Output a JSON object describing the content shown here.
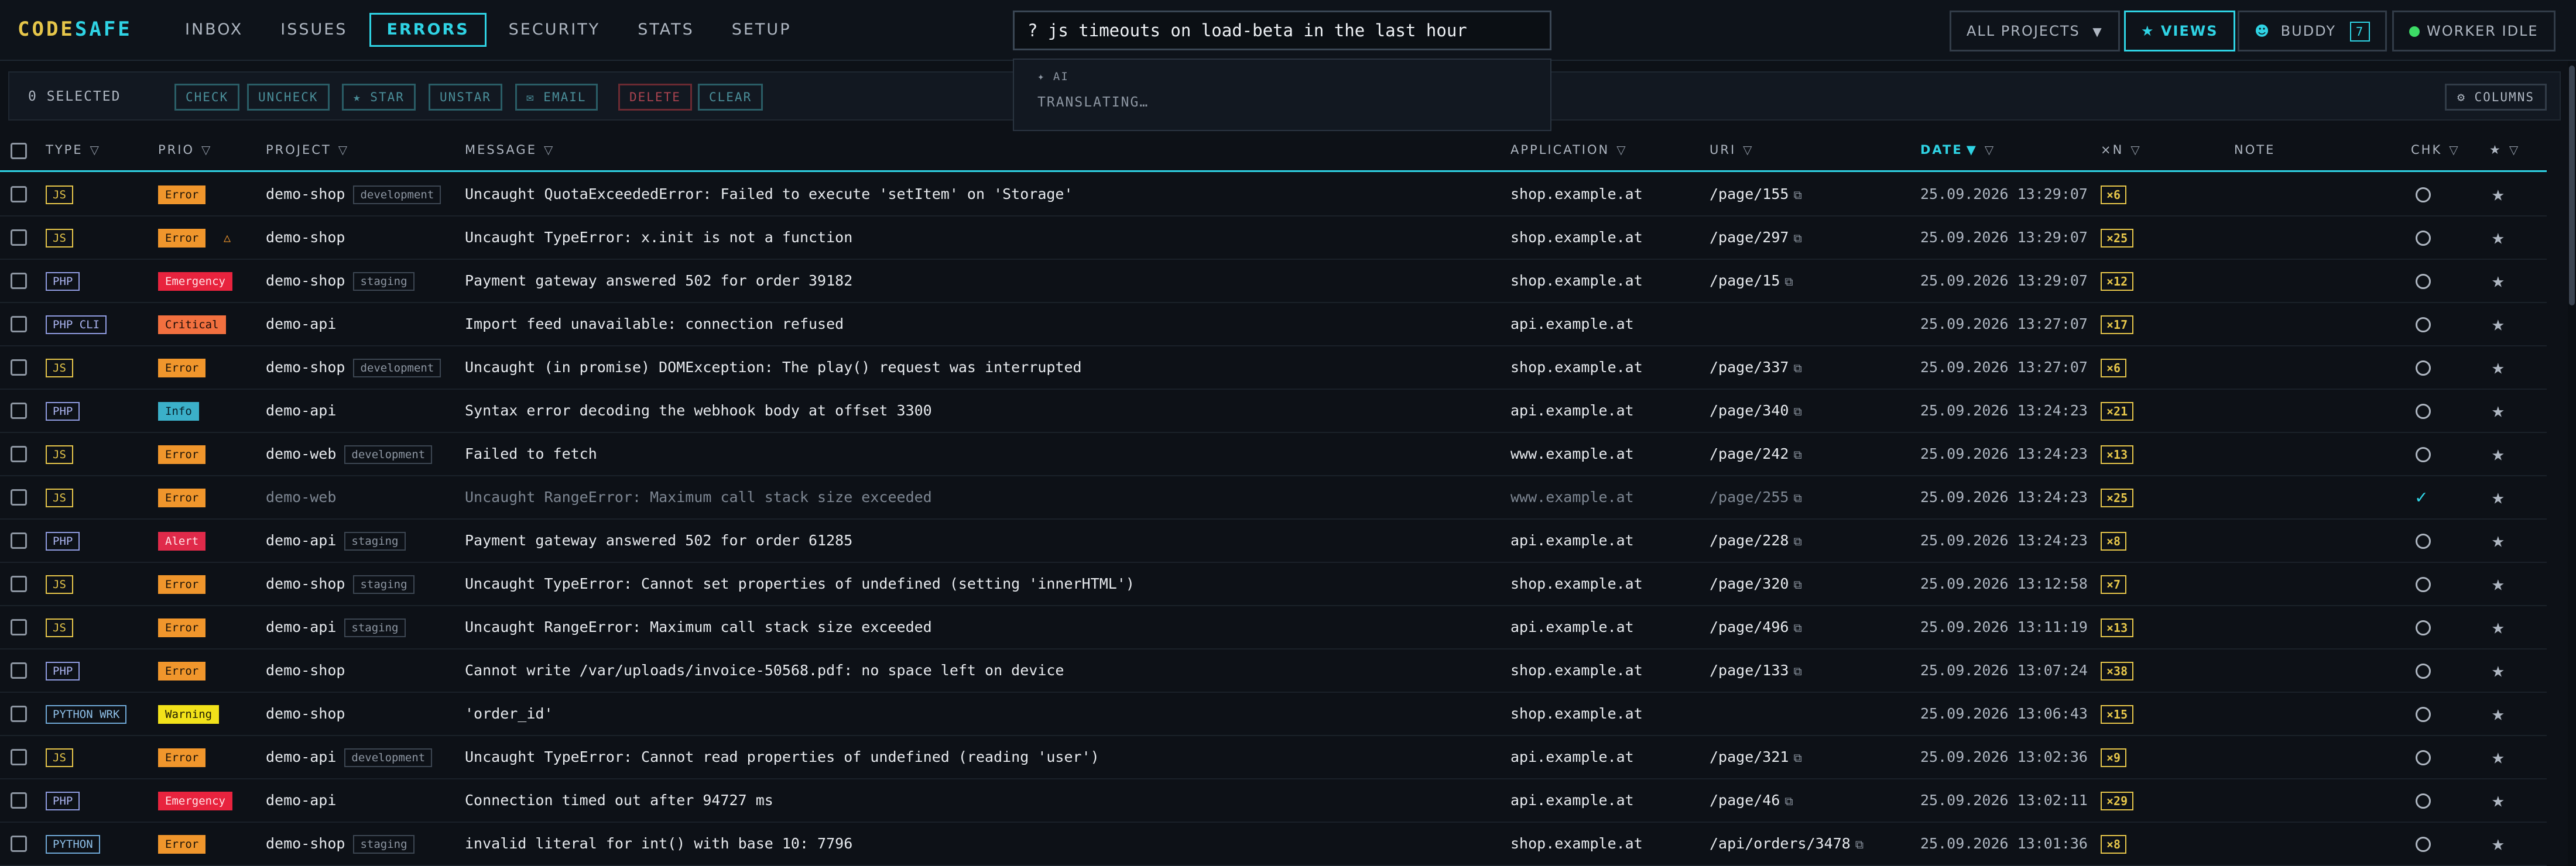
{
  "brand": {
    "part1": "CODE",
    "part2": "SAFE"
  },
  "nav": [
    {
      "label": "INBOX"
    },
    {
      "label": "ISSUES"
    },
    {
      "label": "ERRORS"
    },
    {
      "label": "SECURITY"
    },
    {
      "label": "STATS"
    },
    {
      "label": "SETUP"
    }
  ],
  "search": {
    "value": "? js timeouts on load-beta in the last hour"
  },
  "ai_dropdown": {
    "tag": "✦ AI",
    "status": "TRANSLATING…"
  },
  "toolbar": {
    "projects_label": "ALL PROJECTS",
    "views_label": "VIEWS",
    "buddy_label": "BUDDY",
    "buddy_count": "7",
    "worker_label": "WORKER IDLE"
  },
  "selection": {
    "count_label": "0 SELECTED",
    "check": "CHECK",
    "uncheck": "UNCHECK",
    "star": "STAR",
    "unstar": "UNSTAR",
    "email": "EMAIL",
    "delete": "DELETE",
    "clear": "CLEAR",
    "columns": "COLUMNS"
  },
  "columns": {
    "type": "TYPE",
    "prio": "PRIO",
    "project": "PROJECT",
    "message": "MESSAGE",
    "application": "APPLICATION",
    "uri": "URI",
    "date": "DATE",
    "count": "×N",
    "note": "NOTE",
    "chk": "CHK",
    "star": "★"
  },
  "colors": {
    "accent": "#2fd3e4",
    "brand_yellow": "#e6c64a"
  },
  "rows": [
    {
      "type": "JS",
      "prio": "Error",
      "project": "demo-shop",
      "env": "development",
      "message": "Uncaught QuotaExceededError: Failed to execute 'setItem' on 'Storage'",
      "app": "shop.example.at",
      "uri": "/page/155",
      "date": "25.09.2026 13:29:07",
      "count": "×6",
      "checked": false,
      "dim": false,
      "warn": false
    },
    {
      "type": "JS",
      "prio": "Error",
      "project": "demo-shop",
      "env": "",
      "message": "Uncaught TypeError: x.init is not a function",
      "app": "shop.example.at",
      "uri": "/page/297",
      "date": "25.09.2026 13:29:07",
      "count": "×25",
      "checked": false,
      "dim": false,
      "warn": true
    },
    {
      "type": "PHP",
      "prio": "Emergency",
      "project": "demo-shop",
      "env": "staging",
      "message": "Payment gateway answered 502 for order 39182",
      "app": "shop.example.at",
      "uri": "/page/15",
      "date": "25.09.2026 13:29:07",
      "count": "×12",
      "checked": false,
      "dim": false,
      "warn": false
    },
    {
      "type": "PHP CLI",
      "prio": "Critical",
      "project": "demo-api",
      "env": "",
      "message": "Import feed unavailable: connection refused",
      "app": "api.example.at",
      "uri": "",
      "date": "25.09.2026 13:27:07",
      "count": "×17",
      "checked": false,
      "dim": false,
      "warn": false
    },
    {
      "type": "JS",
      "prio": "Error",
      "project": "demo-shop",
      "env": "development",
      "message": "Uncaught (in promise) DOMException: The play() request was interrupted",
      "app": "shop.example.at",
      "uri": "/page/337",
      "date": "25.09.2026 13:27:07",
      "count": "×6",
      "checked": false,
      "dim": false,
      "warn": false
    },
    {
      "type": "PHP",
      "prio": "Info",
      "project": "demo-api",
      "env": "",
      "message": "Syntax error decoding the webhook body at offset 3300",
      "app": "api.example.at",
      "uri": "/page/340",
      "date": "25.09.2026 13:24:23",
      "count": "×21",
      "checked": false,
      "dim": false,
      "warn": false
    },
    {
      "type": "JS",
      "prio": "Error",
      "project": "demo-web",
      "env": "development",
      "message": "Failed to fetch",
      "app": "www.example.at",
      "uri": "/page/242",
      "date": "25.09.2026 13:24:23",
      "count": "×13",
      "checked": false,
      "dim": false,
      "warn": false
    },
    {
      "type": "JS",
      "prio": "Error",
      "project": "demo-web",
      "env": "",
      "message": "Uncaught RangeError: Maximum call stack size exceeded",
      "app": "www.example.at",
      "uri": "/page/255",
      "date": "25.09.2026 13:24:23",
      "count": "×25",
      "checked": true,
      "dim": true,
      "warn": false
    },
    {
      "type": "PHP",
      "prio": "Alert",
      "project": "demo-api",
      "env": "staging",
      "message": "Payment gateway answered 502 for order 61285",
      "app": "api.example.at",
      "uri": "/page/228",
      "date": "25.09.2026 13:24:23",
      "count": "×8",
      "checked": false,
      "dim": false,
      "warn": false
    },
    {
      "type": "JS",
      "prio": "Error",
      "project": "demo-shop",
      "env": "staging",
      "message": "Uncaught TypeError: Cannot set properties of undefined (setting 'innerHTML')",
      "app": "shop.example.at",
      "uri": "/page/320",
      "date": "25.09.2026 13:12:58",
      "count": "×7",
      "checked": false,
      "dim": false,
      "warn": false
    },
    {
      "type": "JS",
      "prio": "Error",
      "project": "demo-api",
      "env": "staging",
      "message": "Uncaught RangeError: Maximum call stack size exceeded",
      "app": "api.example.at",
      "uri": "/page/496",
      "date": "25.09.2026 13:11:19",
      "count": "×13",
      "checked": false,
      "dim": false,
      "warn": false
    },
    {
      "type": "PHP",
      "prio": "Error",
      "project": "demo-shop",
      "env": "",
      "message": "Cannot write /var/uploads/invoice-50568.pdf: no space left on device",
      "app": "shop.example.at",
      "uri": "/page/133",
      "date": "25.09.2026 13:07:24",
      "count": "×38",
      "checked": false,
      "dim": false,
      "warn": false
    },
    {
      "type": "PYTHON WRK",
      "prio": "Warning",
      "project": "demo-shop",
      "env": "",
      "message": "'order_id'",
      "app": "shop.example.at",
      "uri": "",
      "date": "25.09.2026 13:06:43",
      "count": "×15",
      "checked": false,
      "dim": false,
      "warn": false
    },
    {
      "type": "JS",
      "prio": "Error",
      "project": "demo-api",
      "env": "development",
      "message": "Uncaught TypeError: Cannot read properties of undefined (reading 'user')",
      "app": "api.example.at",
      "uri": "/page/321",
      "date": "25.09.2026 13:02:36",
      "count": "×9",
      "checked": false,
      "dim": false,
      "warn": false
    },
    {
      "type": "PHP",
      "prio": "Emergency",
      "project": "demo-api",
      "env": "",
      "message": "Connection timed out after 94727 ms",
      "app": "api.example.at",
      "uri": "/page/46",
      "date": "25.09.2026 13:02:11",
      "count": "×29",
      "checked": false,
      "dim": false,
      "warn": false
    },
    {
      "type": "PYTHON",
      "prio": "Error",
      "project": "demo-shop",
      "env": "staging",
      "message": "invalid literal for int() with base 10: 7796",
      "app": "shop.example.at",
      "uri": "/api/orders/3478",
      "date": "25.09.2026 13:01:36",
      "count": "×8",
      "checked": false,
      "dim": false,
      "warn": false
    }
  ]
}
